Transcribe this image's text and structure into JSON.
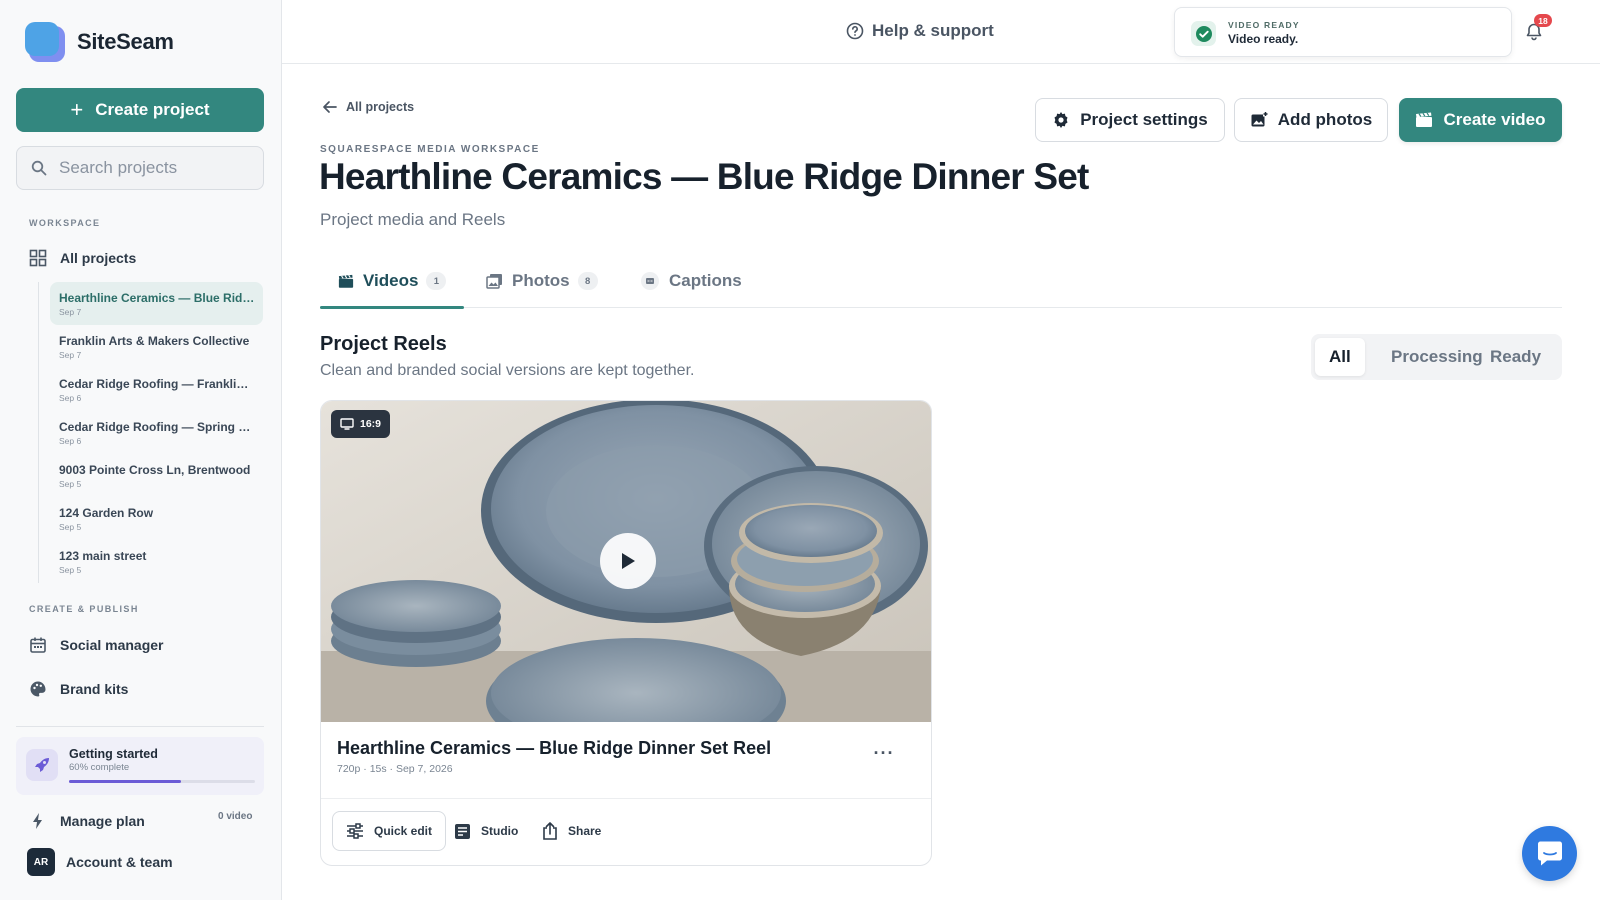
{
  "app": {
    "name": "SiteSeam"
  },
  "sidebar": {
    "create_label": "Create project",
    "search_placeholder": "Search projects",
    "workspace_label": "WORKSPACE",
    "all_projects_label": "All projects",
    "projects": [
      {
        "name": "Hearthline Ceramics — Blue Ridge Dinner Set",
        "date": "Sep 7",
        "active": true
      },
      {
        "name": "Franklin Arts & Makers Collective",
        "date": "Sep 7"
      },
      {
        "name": "Cedar Ridge Roofing — Franklin Project",
        "date": "Sep 6"
      },
      {
        "name": "Cedar Ridge Roofing — Spring Review",
        "date": "Sep 6"
      },
      {
        "name": "9003 Pointe Cross Ln, Brentwood",
        "date": "Sep 5"
      },
      {
        "name": "124 Garden Row",
        "date": "Sep 5"
      },
      {
        "name": "123 main street",
        "date": "Sep 5"
      }
    ],
    "create_publish_label": "CREATE & PUBLISH",
    "social_manager_label": "Social manager",
    "brand_kits_label": "Brand kits",
    "getting_started": {
      "title": "Getting started",
      "subtitle": "60% complete",
      "progress": 0.6
    },
    "manage_plan_label": "Manage plan",
    "plan_count": "0 video",
    "account": {
      "initials": "AR",
      "label": "Account & team"
    }
  },
  "topbar": {
    "help_label": "Help & support",
    "toast": {
      "label": "VIDEO READY",
      "message": "Video ready."
    },
    "notification_count": "18"
  },
  "main": {
    "back_label": "All projects",
    "eyebrow": "SQUARESPACE MEDIA WORKSPACE",
    "title": "Hearthline Ceramics — Blue Ridge Dinner Set",
    "subtitle": "Project media and Reels",
    "buttons": {
      "settings": "Project settings",
      "add_photos": "Add photos",
      "create_video": "Create video"
    },
    "tabs": [
      {
        "label": "Videos",
        "count": "1",
        "active": true
      },
      {
        "label": "Photos",
        "count": "8"
      },
      {
        "label": "Captions"
      }
    ],
    "section": {
      "title": "Project Reels",
      "subtitle": "Clean and branded social versions are kept together."
    },
    "filters": [
      "All",
      "Processing",
      "Ready"
    ],
    "active_filter": "All",
    "card": {
      "ratio": "16:9",
      "title": "Hearthline Ceramics — Blue Ridge Dinner Set Reel",
      "meta": "720p · 15s · Sep 7, 2026",
      "actions": {
        "quick_edit": "Quick edit",
        "studio": "Studio",
        "share": "Share"
      }
    }
  },
  "colors": {
    "accent": "#33877f",
    "progress": "#6b5bd6",
    "badge": "#e5484d",
    "chat": "#2f7ae0"
  }
}
